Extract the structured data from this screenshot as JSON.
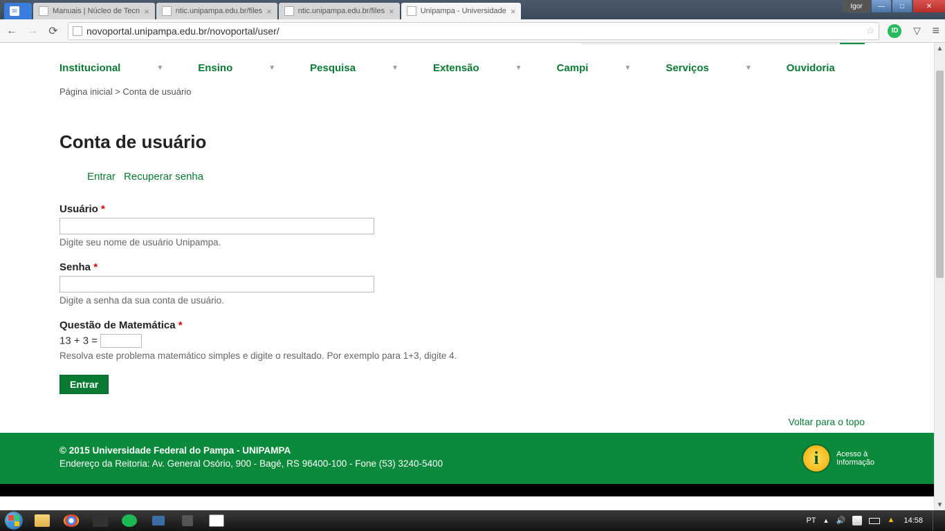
{
  "browser": {
    "tabs": [
      {
        "label": "",
        "active": false
      },
      {
        "label": "Manuais | Núcleo de Tecn",
        "active": false
      },
      {
        "label": "ntic.unipampa.edu.br/files",
        "active": false
      },
      {
        "label": "ntic.unipampa.edu.br/files",
        "active": false
      },
      {
        "label": "Unipampa - Universidade",
        "active": true
      }
    ],
    "user_badge": "Igor",
    "url": "novoportal.unipampa.edu.br/novoportal/user/"
  },
  "nav": {
    "items": [
      "Institucional",
      "Ensino",
      "Pesquisa",
      "Extensão",
      "Campi",
      "Serviços",
      "Ouvidoria"
    ]
  },
  "breadcrumb": "Página inicial > Conta de usuário",
  "page_title": "Conta de usuário",
  "local_tabs": {
    "login": "Entrar",
    "recover": "Recuperar senha"
  },
  "form": {
    "user_label": "Usuário",
    "user_hint": "Digite seu nome de usuário Unipampa.",
    "pass_label": "Senha",
    "pass_hint": "Digite a senha da sua conta de usuário.",
    "math_label": "Questão de Matemática",
    "math_expr": "13 + 3 =",
    "math_hint": "Resolva este problema matemático simples e digite o resultado. Por exemplo para 1+3, digite 4.",
    "submit": "Entrar",
    "required_mark": "*"
  },
  "back_top": "Voltar para o topo",
  "footer": {
    "copyright": "© 2015 Universidade Federal do Pampa - UNIPAMPA",
    "address": "Endereço da Reitoria: Av. General Osório, 900 - Bagé, RS 96400-100 - Fone (53) 3240-5400",
    "info_label1": "Acesso à",
    "info_label2": "Informação"
  },
  "taskbar": {
    "lang": "PT",
    "clock": "14:58"
  }
}
